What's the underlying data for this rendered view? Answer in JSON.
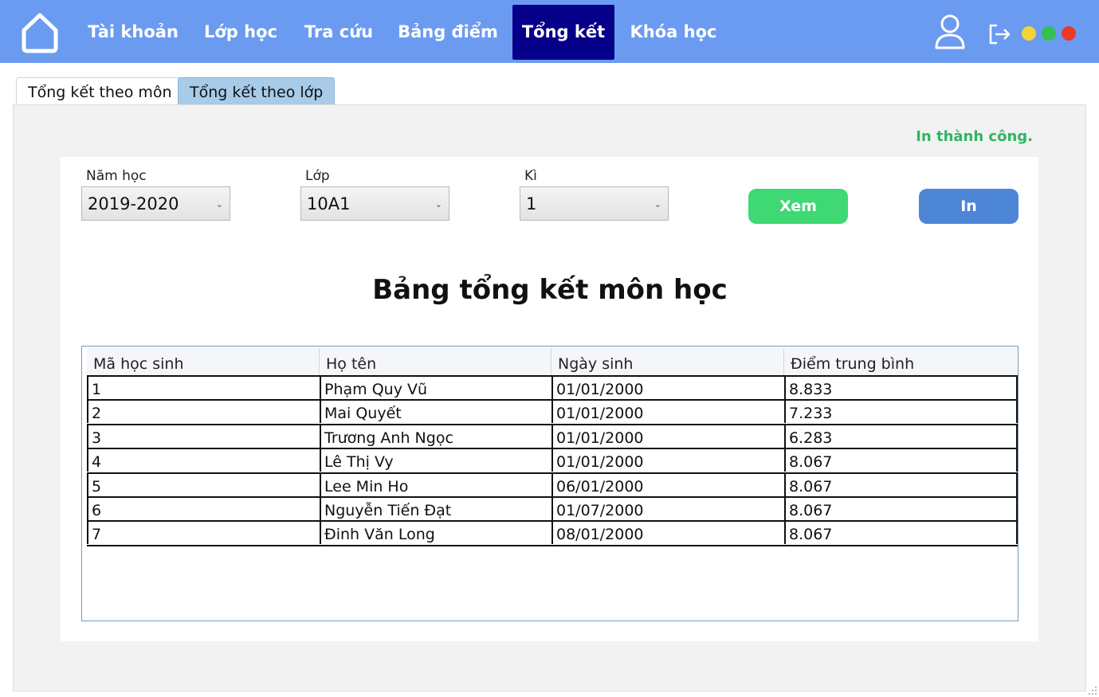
{
  "nav": {
    "items": [
      {
        "label": "Tài khoản",
        "active": false
      },
      {
        "label": "Lớp học",
        "active": false
      },
      {
        "label": "Tra cứu",
        "active": false
      },
      {
        "label": "Bảng điểm",
        "active": false
      },
      {
        "label": "Tổng kết",
        "active": true
      },
      {
        "label": "Khóa học",
        "active": false
      }
    ],
    "icons": {
      "home": "home-icon",
      "user": "user-icon",
      "logout": "logout-icon"
    },
    "window_controls": [
      {
        "name": "minimize",
        "color": "#f2d33a"
      },
      {
        "name": "maximize",
        "color": "#35c04f"
      },
      {
        "name": "close",
        "color": "#ea3a2b"
      }
    ]
  },
  "tabs": [
    {
      "label": "Tổng kết theo môn",
      "active": false
    },
    {
      "label": "Tổng kết theo lớp",
      "active": true
    }
  ],
  "status": {
    "message": "In thành công.",
    "color": "#2fb561"
  },
  "filters": {
    "year": {
      "label": "Năm học",
      "value": "2019-2020"
    },
    "class": {
      "label": "Lớp",
      "value": "10A1"
    },
    "term": {
      "label": "Kì",
      "value": "1"
    }
  },
  "buttons": {
    "view": "Xem",
    "print": "In"
  },
  "table": {
    "title": "Bảng tổng kết môn học",
    "columns": [
      "Mã học sinh",
      "Họ tên",
      "Ngày sinh",
      "Điểm trung bình"
    ],
    "rows": [
      [
        "1",
        "Phạm Quy Vũ",
        "01/01/2000",
        "8.833"
      ],
      [
        "2",
        "Mai Quyết",
        "01/01/2000",
        "7.233"
      ],
      [
        "3",
        "Trương Anh Ngọc",
        "01/01/2000",
        "6.283"
      ],
      [
        "4",
        "Lê Thị Vy",
        "01/01/2000",
        "8.067"
      ],
      [
        "5",
        "Lee Min Ho",
        "06/01/2000",
        "8.067"
      ],
      [
        "6",
        "Nguyễn Tiến Đạt",
        "01/07/2000",
        "8.067"
      ],
      [
        "7",
        "Đinh Văn Long",
        "08/01/2000",
        "8.067"
      ]
    ]
  }
}
